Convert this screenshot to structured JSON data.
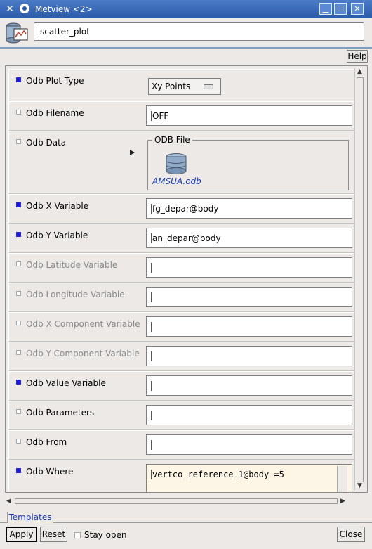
{
  "window": {
    "title": "Metview <2>"
  },
  "header": {
    "name_value": "scatter_plot",
    "help_label": "Help"
  },
  "params": [
    {
      "label": "Odb Plot Type",
      "checked": true,
      "enabled": true,
      "value": "Xy Points"
    },
    {
      "label": "Odb Filename",
      "checked": false,
      "enabled": true,
      "value": "OFF"
    },
    {
      "label": "Odb Data",
      "checked": false,
      "enabled": true,
      "group_title": "ODB File",
      "file_name": "AMSUA.odb"
    },
    {
      "label": "Odb X Variable",
      "checked": true,
      "enabled": true,
      "value": "fg_depar@body"
    },
    {
      "label": "Odb Y Variable",
      "checked": true,
      "enabled": true,
      "value": "an_depar@body"
    },
    {
      "label": "Odb Latitude Variable",
      "checked": false,
      "enabled": false,
      "value": ""
    },
    {
      "label": "Odb Longitude Variable",
      "checked": false,
      "enabled": false,
      "value": ""
    },
    {
      "label": "Odb X Component Variable",
      "checked": false,
      "enabled": false,
      "value": ""
    },
    {
      "label": "Odb Y Component Variable",
      "checked": false,
      "enabled": false,
      "value": ""
    },
    {
      "label": "Odb Value Variable",
      "checked": true,
      "enabled": true,
      "value": ""
    },
    {
      "label": "Odb Parameters",
      "checked": false,
      "enabled": true,
      "value": ""
    },
    {
      "label": "Odb From",
      "checked": false,
      "enabled": true,
      "value": ""
    },
    {
      "label": "Odb Where",
      "checked": true,
      "enabled": true,
      "value": "vertco_reference_1@body =5"
    }
  ],
  "tabs": [
    {
      "label": "Templates"
    }
  ],
  "footer": {
    "apply_label": "Apply",
    "reset_label": "Reset",
    "stay_open_label": "Stay open",
    "close_label": "Close"
  },
  "colors": {
    "titlebar": "#2b5aa8",
    "checked": "#1c1cd8",
    "where_bg": "#fdf5e6"
  }
}
